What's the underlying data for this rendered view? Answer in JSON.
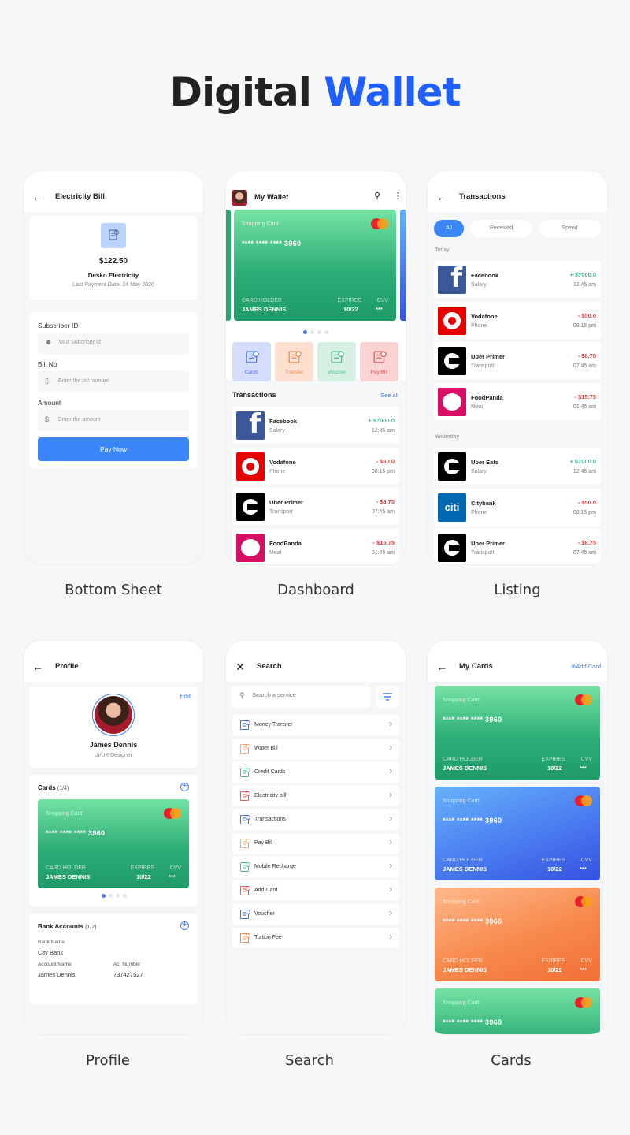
{
  "title": {
    "part1": "Digital",
    "part2": "Wallet"
  },
  "colors": {
    "accent": "#1f5eff",
    "primary_button": "#3b86f7",
    "credit": "#2fc28a",
    "debit": "#e53935",
    "background": "#f7f7f8"
  },
  "screens": {
    "bottom_sheet": {
      "label": "Bottom Sheet",
      "header_title": "Electricity Bill",
      "back_icon": "arrow-left-icon",
      "bill_icon": "bill-icon",
      "amount": "$122.50",
      "biller": "Desko Electricity",
      "last_payment": "Last Payment Date: 24 May 2020",
      "fields": [
        {
          "label": "Subscriber ID",
          "placeholder": "Your Subcriber Id",
          "icon": "user-icon",
          "value": ""
        },
        {
          "label": "Bill No",
          "placeholder": "Enter the bill number",
          "icon": "phone-icon",
          "value": ""
        },
        {
          "label": "Amount",
          "placeholder": "Enter the amount",
          "icon": "dollar-icon",
          "value": ""
        }
      ],
      "button": "Pay Now"
    },
    "dashboard": {
      "label": "Dashboard",
      "title": "My Wallet",
      "card": {
        "type": "Shopping Card",
        "number": "**** **** **** 3960",
        "holder_label": "CARD HOLDER",
        "holder": "JAMES DENNIS",
        "expires_label": "EXPIRES",
        "expires": "10/22",
        "cvv_label": "CVV",
        "cvv": "***",
        "theme": "green",
        "brand": "MasterCard"
      },
      "carousel": {
        "pages": 4,
        "active": 0
      },
      "quick_actions": [
        {
          "label": "Cards",
          "icon": "card-icon",
          "bg": "#d4defc",
          "color": "#4a6fe0"
        },
        {
          "label": "Transfer",
          "icon": "transfer-icon",
          "bg": "#fde0cf",
          "color": "#f08a4b"
        },
        {
          "label": "Voucher",
          "icon": "voucher-icon",
          "bg": "#d6f0e3",
          "color": "#56b98a"
        },
        {
          "label": "Pay Bill",
          "icon": "pay-bill-icon",
          "bg": "#fbd3d3",
          "color": "#e05555"
        }
      ],
      "transactions_title": "Transactions",
      "see_all": "See all",
      "transactions": [
        {
          "name": "Facebook",
          "category": "Salary",
          "amount": "+ $7000.0",
          "time": "12:45 am",
          "type": "credit",
          "logo": "facebook"
        },
        {
          "name": "Vodafone",
          "category": "Phone",
          "amount": "- $50.0",
          "time": "08:15 pm",
          "type": "debit",
          "logo": "vodafone"
        },
        {
          "name": "Uber Primer",
          "category": "Transport",
          "amount": "- $8.75",
          "time": "07:45 am",
          "type": "debit",
          "logo": "uber"
        },
        {
          "name": "FoodPanda",
          "category": "Meal",
          "amount": "- $15.75",
          "time": "01:45 am",
          "type": "debit",
          "logo": "foodpanda"
        }
      ]
    },
    "listing": {
      "label": "Listing",
      "title": "Transactions",
      "filters": [
        {
          "label": "All",
          "active": true
        },
        {
          "label": "Received",
          "active": false
        },
        {
          "label": "Spend",
          "active": false
        }
      ],
      "groups": [
        {
          "title": "Today",
          "items": [
            {
              "name": "Facebook",
              "category": "Salary",
              "amount": "+ $7000.0",
              "time": "12:45 am",
              "type": "credit",
              "logo": "facebook"
            },
            {
              "name": "Vodafone",
              "category": "Phone",
              "amount": "- $50.0",
              "time": "08:15 pm",
              "type": "debit",
              "logo": "vodafone"
            },
            {
              "name": "Uber Primer",
              "category": "Transport",
              "amount": "- $8.75",
              "time": "07:45 am",
              "type": "debit",
              "logo": "uber"
            },
            {
              "name": "FoodPanda",
              "category": "Meal",
              "amount": "- $15.75",
              "time": "01:45 am",
              "type": "debit",
              "logo": "foodpanda"
            }
          ]
        },
        {
          "title": "Yesterday",
          "items": [
            {
              "name": "Uber Eats",
              "category": "Salary",
              "amount": "+ $7000.0",
              "time": "12:45 am",
              "type": "credit",
              "logo": "uber"
            },
            {
              "name": "Citybank",
              "category": "Phone",
              "amount": "- $50.0",
              "time": "08:15 pm",
              "type": "debit",
              "logo": "citi"
            },
            {
              "name": "Uber Primer",
              "category": "Transport",
              "amount": "- $8.75",
              "time": "07:45 am",
              "type": "debit",
              "logo": "uber"
            }
          ]
        }
      ]
    },
    "profile": {
      "label": "Profile",
      "title": "Profile",
      "edit": "Edit",
      "name": "James Dennis",
      "role": "Ui/UX Designer",
      "cards_title": "Cards",
      "cards_count": "(1/4)",
      "card": {
        "type": "Shopping Card",
        "number": "**** **** **** 3960",
        "holder_label": "CARD HOLDER",
        "holder": "JAMES DENNIS",
        "expires_label": "EXPIRES",
        "expires": "10/22",
        "cvv_label": "CVV",
        "cvv": "***",
        "theme": "green",
        "brand": "MasterCard"
      },
      "carousel": {
        "pages": 4,
        "active": 0
      },
      "bank_title": "Bank Accounts",
      "bank_count": "(1/2)",
      "bank_name_label": "Bank Name",
      "bank_name": "City Bank",
      "account_name_label": "Account Name",
      "account_name": "James Dennis",
      "ac_number_label": "Ac. Number",
      "ac_number": "737427527"
    },
    "search": {
      "label": "Search",
      "title": "Search",
      "placeholder": "Search a service",
      "value": "",
      "items": [
        {
          "label": "Money Transfer",
          "icon": "money-transfer-icon",
          "color": "#4a6fe0"
        },
        {
          "label": "Water Bill",
          "icon": "water-bill-icon",
          "color": "#f3a67a"
        },
        {
          "label": "Credit Cards",
          "icon": "credit-cards-icon",
          "color": "#56b98a"
        },
        {
          "label": "Electricity bill",
          "icon": "electricity-bill-icon",
          "color": "#e05a5a"
        },
        {
          "label": "Transactions",
          "icon": "transactions-icon",
          "color": "#4a6fe0"
        },
        {
          "label": "Pay Bill",
          "icon": "pay-bill-icon",
          "color": "#f3a67a"
        },
        {
          "label": "Mobile Recharge",
          "icon": "mobile-recharge-icon",
          "color": "#56b98a"
        },
        {
          "label": "Add Card",
          "icon": "add-card-icon",
          "color": "#e05a5a"
        },
        {
          "label": "Voucher",
          "icon": "voucher-icon",
          "color": "#4a6fe0"
        },
        {
          "label": "Tuition Fee",
          "icon": "tuition-fee-icon",
          "color": "#f08a4b"
        }
      ]
    },
    "cards": {
      "label": "Cards",
      "title": "My Cards",
      "add": "Add Card",
      "cards": [
        {
          "type": "Shopping Card",
          "number": "**** **** **** 3960",
          "holder_label": "CARD HOLDER",
          "holder": "JAMES DENNIS",
          "expires_label": "EXPIRES",
          "expires": "10/22",
          "cvv_label": "CVV",
          "cvv": "***",
          "theme": "green",
          "brand": "MasterCard"
        },
        {
          "type": "Shopping Card",
          "number": "**** **** **** 3960",
          "holder_label": "CARD HOLDER",
          "holder": "JAMES DENNIS",
          "expires_label": "EXPIRES",
          "expires": "10/22",
          "cvv_label": "CVV",
          "cvv": "***",
          "theme": "blue",
          "brand": "MasterCard"
        },
        {
          "type": "Shopping Card",
          "number": "**** **** **** 3960",
          "holder_label": "CARD HOLDER",
          "holder": "JAMES DENNIS",
          "expires_label": "EXPIRES",
          "expires": "10/22",
          "cvv_label": "CVV",
          "cvv": "***",
          "theme": "orange",
          "brand": "MasterCard"
        },
        {
          "type": "Shopping Card",
          "number": "**** **** **** 3960",
          "theme": "green",
          "brand": "MasterCard"
        }
      ]
    }
  }
}
